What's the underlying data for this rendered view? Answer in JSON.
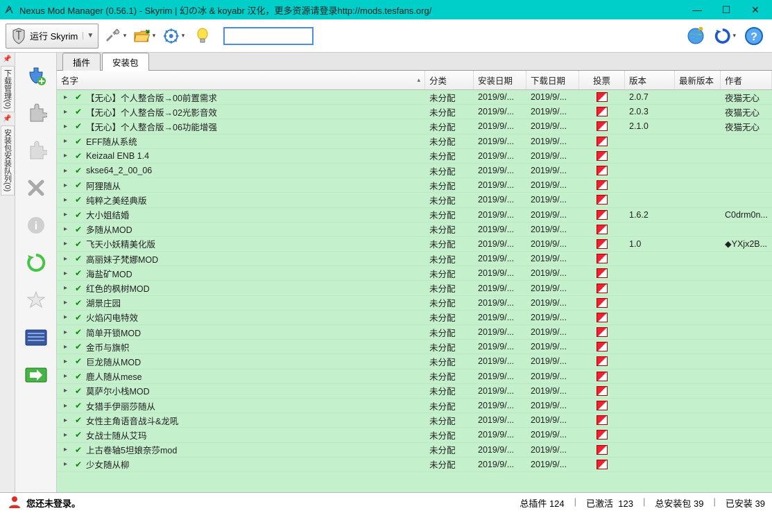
{
  "window": {
    "title": "Nexus Mod Manager (0.56.1) - Skyrim | 幻の冰 & koyabr 汉化，更多资源请登录http://mods.tesfans.org/"
  },
  "toolbar": {
    "run_label": "运行 Skyrim",
    "search_placeholder": ""
  },
  "tabs": {
    "plugins": "插件",
    "packages": "安装包"
  },
  "columns": {
    "name": "名字",
    "category": "分类",
    "install_date": "安装日期",
    "download_date": "下载日期",
    "vote": "投票",
    "version": "版本",
    "latest": "最新版本",
    "author": "作者"
  },
  "left_rail": {
    "tab1": "下载管理(0)",
    "tab2": "安装包安装队列(0)"
  },
  "mods": [
    {
      "name": "【无心】个人整合版→00前置需求",
      "cat": "未分配",
      "idate": "2019/9/...",
      "ddate": "2019/9/...",
      "ver": "2.0.7",
      "author": "夜猫无心"
    },
    {
      "name": "【无心】个人整合版→02光影音效",
      "cat": "未分配",
      "idate": "2019/9/...",
      "ddate": "2019/9/...",
      "ver": "2.0.3",
      "author": "夜猫无心"
    },
    {
      "name": "【无心】个人整合版→06功能增强",
      "cat": "未分配",
      "idate": "2019/9/...",
      "ddate": "2019/9/...",
      "ver": "2.1.0",
      "author": "夜猫无心"
    },
    {
      "name": "EFF随从系统",
      "cat": "未分配",
      "idate": "2019/9/...",
      "ddate": "2019/9/...",
      "ver": "",
      "author": ""
    },
    {
      "name": "Keizaal ENB 1.4",
      "cat": "未分配",
      "idate": "2019/9/...",
      "ddate": "2019/9/...",
      "ver": "",
      "author": ""
    },
    {
      "name": "skse64_2_00_06",
      "cat": "未分配",
      "idate": "2019/9/...",
      "ddate": "2019/9/...",
      "ver": "",
      "author": ""
    },
    {
      "name": "阿狸随从",
      "cat": "未分配",
      "idate": "2019/9/...",
      "ddate": "2019/9/...",
      "ver": "",
      "author": ""
    },
    {
      "name": "纯粹之美经典版",
      "cat": "未分配",
      "idate": "2019/9/...",
      "ddate": "2019/9/...",
      "ver": "",
      "author": ""
    },
    {
      "name": "大小姐结婚",
      "cat": "未分配",
      "idate": "2019/9/...",
      "ddate": "2019/9/...",
      "ver": "1.6.2",
      "author": "C0drm0n..."
    },
    {
      "name": "多随从MOD",
      "cat": "未分配",
      "idate": "2019/9/...",
      "ddate": "2019/9/...",
      "ver": "",
      "author": ""
    },
    {
      "name": "飞天小妖精美化版",
      "cat": "未分配",
      "idate": "2019/9/...",
      "ddate": "2019/9/...",
      "ver": "1.0",
      "author": "◆YXjx2B..."
    },
    {
      "name": "高丽妹子梵娜MOD",
      "cat": "未分配",
      "idate": "2019/9/...",
      "ddate": "2019/9/...",
      "ver": "",
      "author": ""
    },
    {
      "name": "海盐矿MOD",
      "cat": "未分配",
      "idate": "2019/9/...",
      "ddate": "2019/9/...",
      "ver": "",
      "author": ""
    },
    {
      "name": "红色的枫树MOD",
      "cat": "未分配",
      "idate": "2019/9/...",
      "ddate": "2019/9/...",
      "ver": "",
      "author": ""
    },
    {
      "name": "湖景庄园",
      "cat": "未分配",
      "idate": "2019/9/...",
      "ddate": "2019/9/...",
      "ver": "",
      "author": ""
    },
    {
      "name": "火焰闪电特效",
      "cat": "未分配",
      "idate": "2019/9/...",
      "ddate": "2019/9/...",
      "ver": "",
      "author": ""
    },
    {
      "name": "简单开锁MOD",
      "cat": "未分配",
      "idate": "2019/9/...",
      "ddate": "2019/9/...",
      "ver": "",
      "author": ""
    },
    {
      "name": "金币与旗帜",
      "cat": "未分配",
      "idate": "2019/9/...",
      "ddate": "2019/9/...",
      "ver": "",
      "author": ""
    },
    {
      "name": "巨龙随从MOD",
      "cat": "未分配",
      "idate": "2019/9/...",
      "ddate": "2019/9/...",
      "ver": "",
      "author": ""
    },
    {
      "name": "鹿人随从mese",
      "cat": "未分配",
      "idate": "2019/9/...",
      "ddate": "2019/9/...",
      "ver": "",
      "author": ""
    },
    {
      "name": "莫萨尔小栈MOD",
      "cat": "未分配",
      "idate": "2019/9/...",
      "ddate": "2019/9/...",
      "ver": "",
      "author": ""
    },
    {
      "name": "女猎手伊丽莎随从",
      "cat": "未分配",
      "idate": "2019/9/...",
      "ddate": "2019/9/...",
      "ver": "",
      "author": ""
    },
    {
      "name": "女性主角语音战斗&龙吼",
      "cat": "未分配",
      "idate": "2019/9/...",
      "ddate": "2019/9/...",
      "ver": "",
      "author": ""
    },
    {
      "name": "女战士随从艾玛",
      "cat": "未分配",
      "idate": "2019/9/...",
      "ddate": "2019/9/...",
      "ver": "",
      "author": ""
    },
    {
      "name": "上古卷轴5坦娘奈莎mod",
      "cat": "未分配",
      "idate": "2019/9/...",
      "ddate": "2019/9/...",
      "ver": "",
      "author": ""
    },
    {
      "name": "少女随从柳",
      "cat": "未分配",
      "idate": "2019/9/...",
      "ddate": "2019/9/...",
      "ver": "",
      "author": ""
    }
  ],
  "status": {
    "login": "您还未登录。",
    "total_plugins_label": "总插件",
    "total_plugins": "124",
    "activated_label": "已激活",
    "activated": "123",
    "total_packages_label": "总安装包",
    "total_packages": "39",
    "installed_label": "已安装",
    "installed": "39"
  }
}
